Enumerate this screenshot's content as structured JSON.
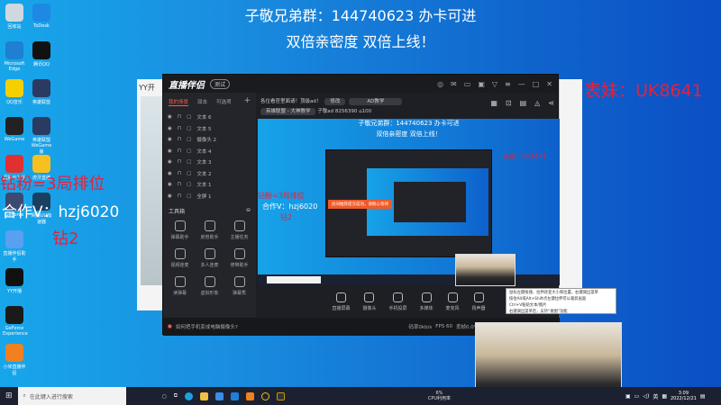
{
  "overlay": {
    "line1": "子敬兄弟群：144740623 办卡可进",
    "line2": "双倍亲密度 双倍上线！",
    "left1": "钻粉=3局排位",
    "left2": "合作V：hzj6020",
    "left3": "钻2",
    "right1": "表妹：UK8641"
  },
  "desktop_icons": [
    "回收站",
    "ToDesk",
    "Microsoft Edge",
    "腾讯QQ",
    "QQ音乐",
    "英雄联盟",
    "WeGame",
    "英雄联盟WeGame版",
    "网易云音乐",
    "虎牙直播",
    "GeForce",
    "网易UU加速器",
    "直播伴侣助手",
    "YY开播",
    "GeForce Experience",
    "小米直播伴侣"
  ],
  "yy_window": {
    "title": "YY开"
  },
  "app": {
    "name": "直播伴侣",
    "beta": "测试",
    "tabs": [
      "我的场景",
      "双击",
      "可选项"
    ],
    "layers": [
      "文本 6",
      "文本 5",
      "摄像头 2",
      "文本 4",
      "文本 3",
      "文本 2",
      "文本 1",
      "全屏 1"
    ],
    "toolbox_label": "工具箱",
    "tools": [
      "弹幕助手",
      "房管助手",
      "主播任务",
      "视频连麦",
      "多人连麦",
      "修带助手",
      "读弹幕",
      "虚拟形象",
      "弹幕秀"
    ],
    "room_title": "各位看官里面请！顶级ad！",
    "edit_label": "修改",
    "tag": "AD教学",
    "category": "英雄联盟 - 大神教学",
    "streamer": "子敬ad",
    "room_id": "8256390",
    "popularity": "100",
    "bottom_tools": [
      "直播屏幕",
      "摄像头",
      "手机投屏",
      "多媒体",
      "麦克风",
      "扬声器"
    ],
    "status_tip": "如何把手机变成电脑摄像头?",
    "bitrate": "码率0kb/s",
    "fps": "FPS 60",
    "dropped": "丢帧0.0%",
    "notice": "房间推荐提交成功，请耐心等待"
  },
  "tooltip": [
    "鼠标左键拖拽、拉伸改变大小和位置，右键调出菜单",
    "按住Alt或Alt+Shift点左键拉伸可以裁剪画面",
    "Ctrl+V粘贴文本/图片",
    "右键调出菜单后，支持“抠图”功能"
  ],
  "taskbar": {
    "search_placeholder": "在此键入进行搜索",
    "cpu": "6%",
    "cpu_label": "CPU利用率",
    "time": "3:09",
    "date": "2022/12/21",
    "ime": "英"
  }
}
